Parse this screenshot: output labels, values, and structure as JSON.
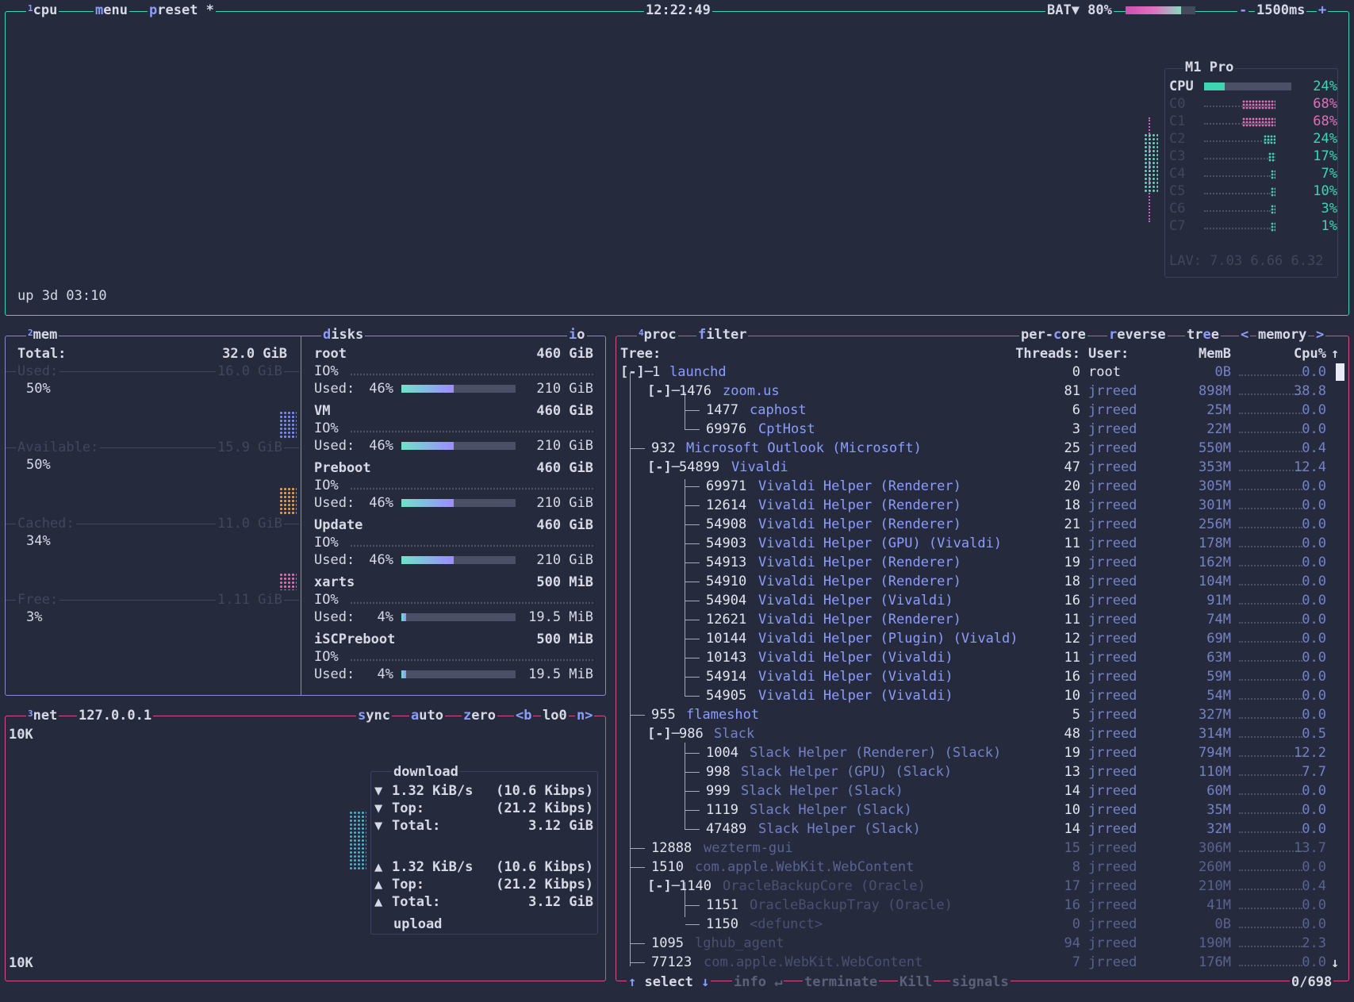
{
  "cpu": {
    "num": "1",
    "title": "cpu",
    "menu": "menu",
    "preset": "preset *",
    "clock": "12:22:49",
    "battery": {
      "label": "BAT▼ 80%",
      "level": 0.8
    },
    "interval": "1500ms",
    "minus": "-",
    "plus": "+",
    "uptime": "up 3d 03:10",
    "model": "M1 Pro",
    "total": {
      "label": "CPU",
      "value": "24%",
      "level": 0.24
    },
    "cores": [
      {
        "label": "C0",
        "value": "68%"
      },
      {
        "label": "C1",
        "value": "68%"
      },
      {
        "label": "C2",
        "value": "24%"
      },
      {
        "label": "C3",
        "value": "17%"
      },
      {
        "label": "C4",
        "value": "7%"
      },
      {
        "label": "C5",
        "value": "10%"
      },
      {
        "label": "C6",
        "value": "3%"
      },
      {
        "label": "C7",
        "value": "1%"
      }
    ],
    "lav": "LAV: 7.03 6.66 6.32"
  },
  "mem": {
    "num": "2",
    "title": "mem",
    "total_label": "Total:",
    "total_value": "32.0 GiB",
    "items": [
      {
        "label": "Used:",
        "value": "16.0 GiB",
        "pct": "50%"
      },
      {
        "label": "Available:",
        "value": "15.9 GiB",
        "pct": "50%"
      },
      {
        "label": "Cached:",
        "value": "11.0 GiB",
        "pct": "34%"
      },
      {
        "label": "Free:",
        "value": "1.11 GiB",
        "pct": "3%"
      }
    ]
  },
  "disks": {
    "title": "disks",
    "io": "io",
    "items": [
      {
        "name": "root",
        "size": "460 GiB",
        "io": "IO%",
        "used_label": "Used:",
        "used_pct": "46%",
        "used_val": "210 GiB",
        "level": 0.46
      },
      {
        "name": "VM",
        "size": "460 GiB",
        "io": "IO%",
        "used_label": "Used:",
        "used_pct": "46%",
        "used_val": "210 GiB",
        "level": 0.46
      },
      {
        "name": "Preboot",
        "size": "460 GiB",
        "io": "IO%",
        "used_label": "Used:",
        "used_pct": "46%",
        "used_val": "210 GiB",
        "level": 0.46
      },
      {
        "name": "Update",
        "size": "460 GiB",
        "io": "IO%",
        "used_label": "Used:",
        "used_pct": "46%",
        "used_val": "210 GiB",
        "level": 0.46
      },
      {
        "name": "xarts",
        "size": "500 MiB",
        "io": "IO%",
        "used_label": "Used:",
        "used_pct": "4%",
        "used_val": "19.5 MiB",
        "level": 0.04
      },
      {
        "name": "iSCPreboot",
        "size": "500 MiB",
        "io": "IO%",
        "used_label": "Used:",
        "used_pct": "4%",
        "used_val": "19.5 MiB",
        "level": 0.04
      }
    ]
  },
  "net": {
    "num": "3",
    "title": "net",
    "ip": "127.0.0.1",
    "sync": "sync",
    "auto": "auto",
    "zero": "zero",
    "prev": "<b",
    "iface": "lo0",
    "next": "n>",
    "scale_top": "10K",
    "scale_bottom": "10K",
    "download_title": "download",
    "download": [
      {
        "arrow": "▼",
        "label": "1.32 KiB/s",
        "value": "(10.6 Kibps)"
      },
      {
        "arrow": "▼",
        "label": "Top:",
        "value": "(21.2 Kibps)"
      },
      {
        "arrow": "▼",
        "label": "Total:",
        "value": "3.12 GiB"
      }
    ],
    "upload": [
      {
        "arrow": "▲",
        "label": "1.32 KiB/s",
        "value": "(10.6 Kibps)"
      },
      {
        "arrow": "▲",
        "label": "Top:",
        "value": "(21.2 Kibps)"
      },
      {
        "arrow": "▲",
        "label": "Total:",
        "value": "3.12 GiB"
      }
    ],
    "upload_title": "upload"
  },
  "proc": {
    "num": "4",
    "title": "proc",
    "filter": "filter",
    "per_core": "per-core",
    "reverse": "reverse",
    "tree": "tree",
    "sort_prev": "<",
    "sort": "memory",
    "sort_next": ">",
    "columns": {
      "tree": "Tree:",
      "threads": "Threads:",
      "user": "User:",
      "mem": "MemB",
      "cpu": "Cpu%",
      "sort_arrow": "↑"
    },
    "rows": [
      {
        "prefix": "[-]─",
        "pid": "1",
        "name": "launchd",
        "threads": "0",
        "user": "root",
        "mem": "0B",
        "cpu": "0.0"
      },
      {
        "prefix": "   [-]─",
        "pid": "1476",
        "name": "zoom.us",
        "threads": "81",
        "user": "jrreed",
        "mem": "898M",
        "cpu": "38.8"
      },
      {
        "prefix": "          ",
        "pid": "1477",
        "name": "caphost",
        "threads": "6",
        "user": "jrreed",
        "mem": "25M",
        "cpu": "0.0"
      },
      {
        "prefix": "          ",
        "pid": "69976",
        "name": "CptHost",
        "threads": "3",
        "user": "jrreed",
        "mem": "22M",
        "cpu": "0.0"
      },
      {
        "prefix": "       ",
        "pid": "932",
        "name": "Microsoft Outlook (Microsoft)",
        "threads": "25",
        "user": "jrreed",
        "mem": "550M",
        "cpu": "0.4"
      },
      {
        "prefix": "   [-]─",
        "pid": "54899",
        "name": "Vivaldi",
        "threads": "47",
        "user": "jrreed",
        "mem": "353M",
        "cpu": "12.4"
      },
      {
        "prefix": "          ",
        "pid": "69971",
        "name": "Vivaldi Helper (Renderer)",
        "threads": "20",
        "user": "jrreed",
        "mem": "305M",
        "cpu": "0.0"
      },
      {
        "prefix": "          ",
        "pid": "12614",
        "name": "Vivaldi Helper (Renderer)",
        "threads": "18",
        "user": "jrreed",
        "mem": "301M",
        "cpu": "0.0"
      },
      {
        "prefix": "          ",
        "pid": "54908",
        "name": "Vivaldi Helper (Renderer)",
        "threads": "21",
        "user": "jrreed",
        "mem": "256M",
        "cpu": "0.0"
      },
      {
        "prefix": "          ",
        "pid": "54903",
        "name": "Vivaldi Helper (GPU) (Vivaldi)",
        "threads": "11",
        "user": "jrreed",
        "mem": "178M",
        "cpu": "0.0"
      },
      {
        "prefix": "          ",
        "pid": "54913",
        "name": "Vivaldi Helper (Renderer)",
        "threads": "19",
        "user": "jrreed",
        "mem": "162M",
        "cpu": "0.0"
      },
      {
        "prefix": "          ",
        "pid": "54910",
        "name": "Vivaldi Helper (Renderer)",
        "threads": "18",
        "user": "jrreed",
        "mem": "104M",
        "cpu": "0.0"
      },
      {
        "prefix": "          ",
        "pid": "54904",
        "name": "Vivaldi Helper (Vivaldi)",
        "threads": "16",
        "user": "jrreed",
        "mem": "91M",
        "cpu": "0.0"
      },
      {
        "prefix": "          ",
        "pid": "12621",
        "name": "Vivaldi Helper (Renderer)",
        "threads": "11",
        "user": "jrreed",
        "mem": "74M",
        "cpu": "0.0"
      },
      {
        "prefix": "          ",
        "pid": "10144",
        "name": "Vivaldi Helper (Plugin) (Vivald)",
        "threads": "12",
        "user": "jrreed",
        "mem": "69M",
        "cpu": "0.0"
      },
      {
        "prefix": "          ",
        "pid": "10143",
        "name": "Vivaldi Helper (Vivaldi)",
        "threads": "11",
        "user": "jrreed",
        "mem": "63M",
        "cpu": "0.0"
      },
      {
        "prefix": "          ",
        "pid": "54914",
        "name": "Vivaldi Helper (Vivaldi)",
        "threads": "16",
        "user": "jrreed",
        "mem": "59M",
        "cpu": "0.0"
      },
      {
        "prefix": "          ",
        "pid": "54905",
        "name": "Vivaldi Helper (Vivaldi)",
        "threads": "10",
        "user": "jrreed",
        "mem": "54M",
        "cpu": "0.0"
      },
      {
        "prefix": "       ",
        "pid": "955",
        "name": "flameshot",
        "threads": "5",
        "user": "jrreed",
        "mem": "327M",
        "cpu": "0.0"
      },
      {
        "prefix": "   [-]─",
        "pid": "986",
        "name": "Slack",
        "threads": "48",
        "user": "jrreed",
        "mem": "314M",
        "cpu": "0.5"
      },
      {
        "prefix": "          ",
        "pid": "1004",
        "name": "Slack Helper (Renderer) (Slack)",
        "threads": "19",
        "user": "jrreed",
        "mem": "794M",
        "cpu": "12.2"
      },
      {
        "prefix": "          ",
        "pid": "998",
        "name": "Slack Helper (GPU) (Slack)",
        "threads": "13",
        "user": "jrreed",
        "mem": "110M",
        "cpu": "7.7"
      },
      {
        "prefix": "          ",
        "pid": "999",
        "name": "Slack Helper (Slack)",
        "threads": "14",
        "user": "jrreed",
        "mem": "60M",
        "cpu": "0.0"
      },
      {
        "prefix": "          ",
        "pid": "1119",
        "name": "Slack Helper (Slack)",
        "threads": "10",
        "user": "jrreed",
        "mem": "35M",
        "cpu": "0.0"
      },
      {
        "prefix": "          ",
        "pid": "47489",
        "name": "Slack Helper (Slack)",
        "threads": "14",
        "user": "jrreed",
        "mem": "32M",
        "cpu": "0.0"
      },
      {
        "prefix": "       ",
        "pid": "12888",
        "name": "wezterm-gui",
        "threads": "15",
        "user": "jrreed",
        "mem": "306M",
        "cpu": "13.7"
      },
      {
        "prefix": "       ",
        "pid": "1510",
        "name": "com.apple.WebKit.WebContent",
        "threads": "8",
        "user": "jrreed",
        "mem": "260M",
        "cpu": "0.0"
      },
      {
        "prefix": "   [-]─",
        "pid": "1140",
        "name": "OracleBackupCore (Oracle)",
        "threads": "17",
        "user": "jrreed",
        "mem": "210M",
        "cpu": "0.4"
      },
      {
        "prefix": "          ",
        "pid": "1151",
        "name": "OracleBackupTray (Oracle)",
        "threads": "16",
        "user": "jrreed",
        "mem": "41M",
        "cpu": "0.0"
      },
      {
        "prefix": "          ",
        "pid": "1150",
        "name": "<defunct>",
        "threads": "0",
        "user": "jrreed",
        "mem": "0B",
        "cpu": "0.0"
      },
      {
        "prefix": "       ",
        "pid": "1095",
        "name": "lghub_agent",
        "threads": "94",
        "user": "jrreed",
        "mem": "190M",
        "cpu": "2.3"
      },
      {
        "prefix": "       ",
        "pid": "77123",
        "name": "com.apple.WebKit.WebContent",
        "threads": "7",
        "user": "jrreed",
        "mem": "176M",
        "cpu": "0.0"
      }
    ],
    "footer": {
      "select_up": "↑",
      "select": "select",
      "select_down": "↓",
      "info": "info",
      "enter": "↵",
      "terminate": "terminate",
      "kill": "Kill",
      "signals": "signals",
      "count": "0/698",
      "down_arrow": "↓"
    }
  }
}
